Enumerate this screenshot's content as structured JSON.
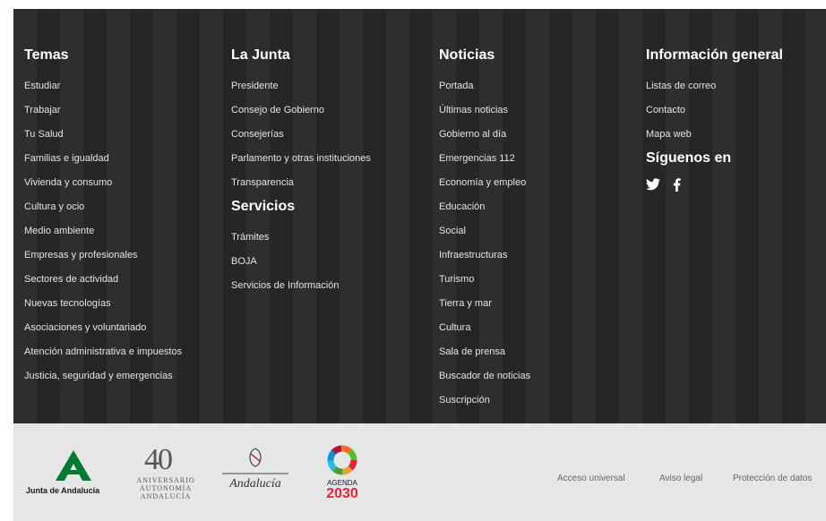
{
  "temas": {
    "title": "Temas",
    "items": [
      "Estudiar",
      "Trabajar",
      "Tu Salud",
      "Familias e igualdad",
      "Vivienda y consumo",
      "Cultura y ocio",
      "Medio ambiente",
      "Empresas y profesionales",
      "Sectores de actividad",
      "Nuevas tecnologías",
      "Asociaciones y voluntariado",
      "Atención administrativa e impuestos",
      "Justicia, seguridad y emergencias"
    ]
  },
  "junta": {
    "title": "La Junta",
    "items": [
      "Presidente",
      "Consejo de Gobierno",
      "Consejerías",
      "Parlamento y otras instituciones",
      "Transparencia"
    ]
  },
  "servicios": {
    "title": "Servicios",
    "items": [
      "Trámites",
      "BOJA",
      "Servicios de Información"
    ]
  },
  "noticias": {
    "title": "Noticias",
    "items": [
      "Portada",
      "Últimas noticias",
      "Gobierno al día",
      "Emergencias 112",
      "Economía y empleo",
      "Educación",
      "Social",
      "Infraestructuras",
      "Turismo",
      "Tierra y mar",
      "Cultura",
      "Sala de prensa",
      "Buscador de noticias",
      "Suscripción"
    ]
  },
  "info": {
    "title": "Información general",
    "items": [
      "Listas de correo",
      "Contacto",
      "Mapa web"
    ]
  },
  "siguenos": {
    "title": "Síguenos en",
    "twitter": "twitter-icon",
    "facebook": "facebook-icon"
  },
  "logos": {
    "junta": "Junta de Andalucía",
    "aniv_num": "40",
    "aniv_l1": "ANIVERSARIO",
    "aniv_l2": "AUTONOMÍA",
    "aniv_l3": "ANDALUCÍA",
    "andalucia": "Andalucía",
    "agenda": "AGENDA",
    "agenda_year": "2030"
  },
  "legal": {
    "acceso": "Acceso universal",
    "aviso": "Aviso legal",
    "proteccion": "Protección de datos"
  },
  "colors": {
    "footer_bg": "#2b2b2b",
    "bottom_bg": "#e6e6e6",
    "junta_green": "#007a33",
    "agenda_red": "#e5243b"
  }
}
